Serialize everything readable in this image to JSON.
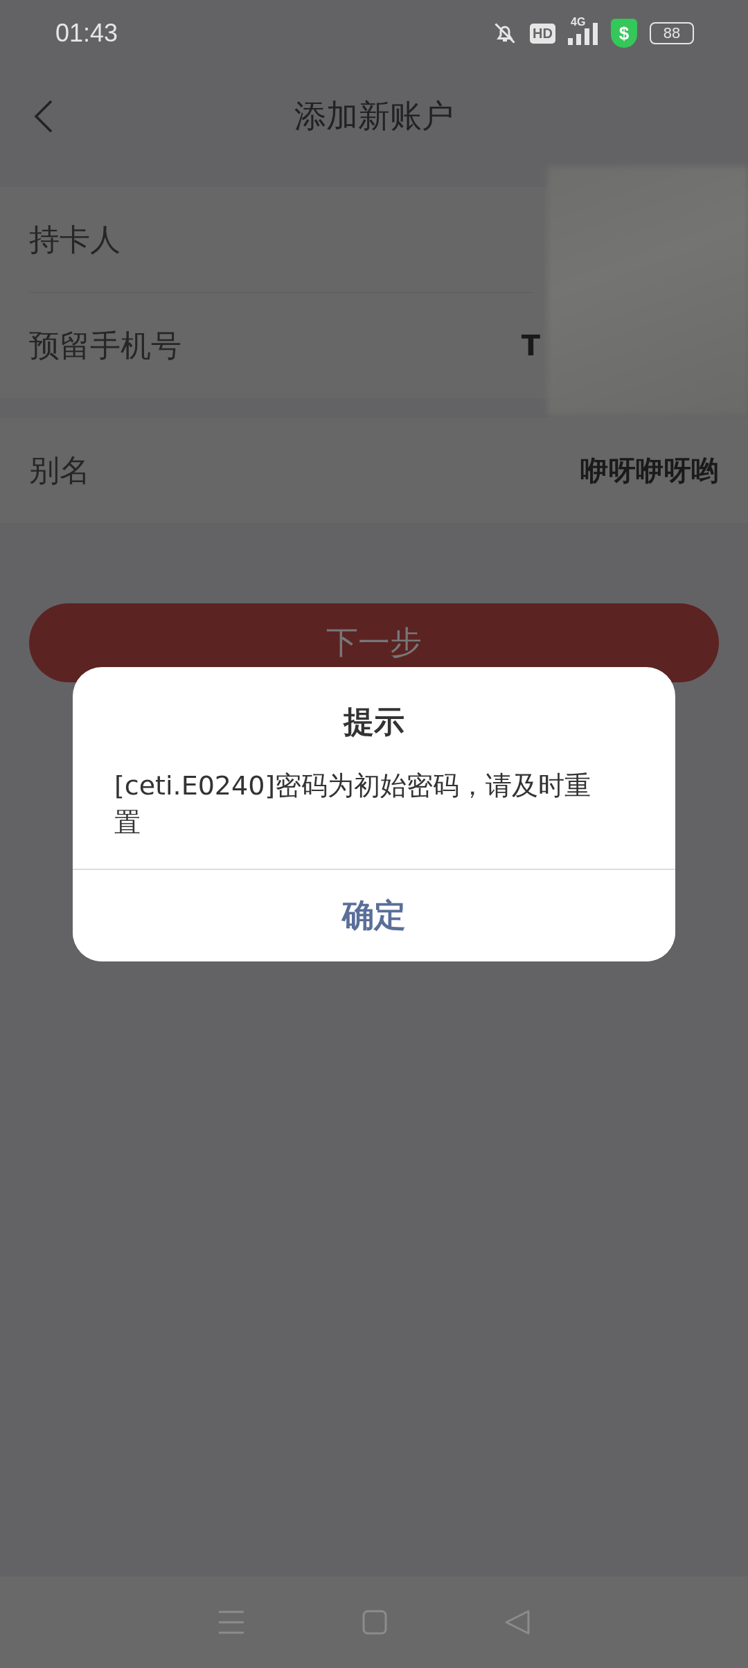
{
  "status_bar": {
    "time": "01:43",
    "hd": "HD",
    "network": "4G",
    "security": "$",
    "battery": "88"
  },
  "header": {
    "title": "添加新账户"
  },
  "form_sections": [
    {
      "fields": [
        {
          "label": "持卡人"
        },
        {
          "label": "预留手机号",
          "value": "T"
        }
      ]
    },
    {
      "fields": [
        {
          "label": "别名",
          "value": "咿呀咿呀哟"
        }
      ]
    }
  ],
  "next_button": {
    "label": "下一步"
  },
  "dialog": {
    "title": "提示",
    "message": "[ceti.E0240]密码为初始密码，请及时重置",
    "confirm": "确定"
  }
}
